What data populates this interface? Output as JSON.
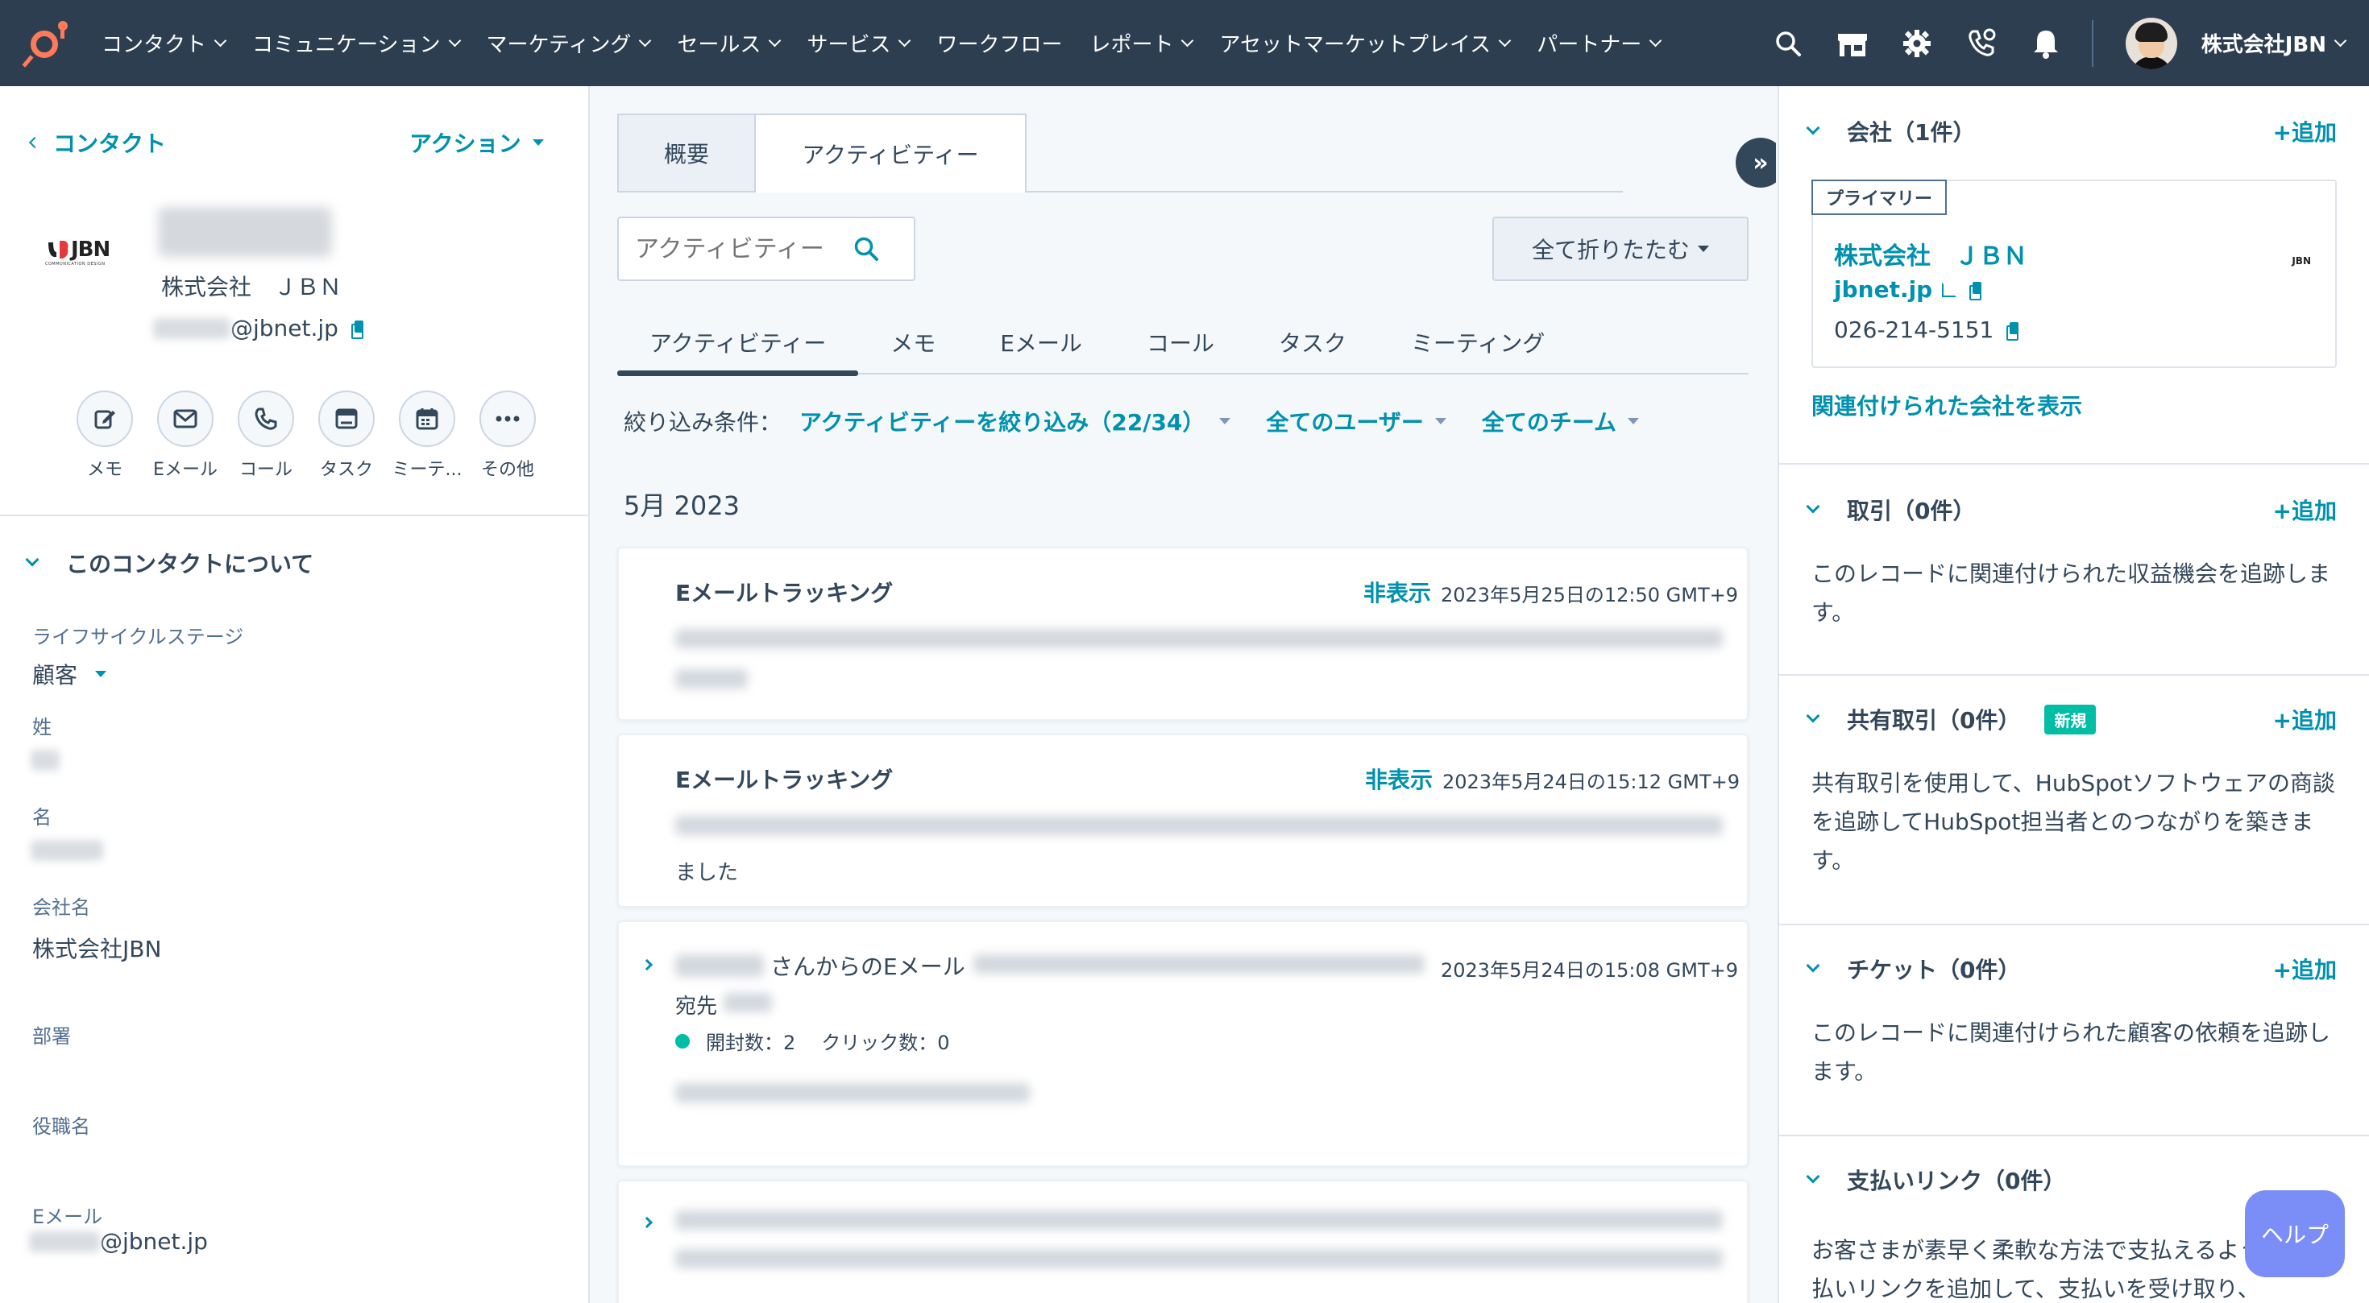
{
  "nav": {
    "items": [
      {
        "label": "コンタクト"
      },
      {
        "label": "コミュニケーション"
      },
      {
        "label": "マーケティング"
      },
      {
        "label": "セールス"
      },
      {
        "label": "サービス"
      },
      {
        "label": "ワークフロー"
      },
      {
        "label": "レポート"
      },
      {
        "label": "アセットマーケットプレイス"
      },
      {
        "label": "パートナー"
      }
    ],
    "account_name": "株式会社JBN",
    "brand_color": "#ff7a59",
    "bg_color": "#2d3e50"
  },
  "left": {
    "back_label": "コンタクト",
    "action_label": "アクション",
    "company_logo_text": "JBN",
    "company_logo_sub": "COMMUNICATION DESIGN",
    "company": "株式会社　ＪＢＮ",
    "email_domain": "@jbnet.jp",
    "quick_actions": [
      {
        "label": "メモ",
        "icon": "edit-icon"
      },
      {
        "label": "Eメール",
        "icon": "email-icon"
      },
      {
        "label": "コール",
        "icon": "phone-icon"
      },
      {
        "label": "タスク",
        "icon": "task-icon"
      },
      {
        "label": "ミーテ...",
        "icon": "calendar-icon"
      },
      {
        "label": "その他",
        "icon": "more-icon"
      }
    ],
    "about_title": "このコンタクトについて",
    "fields": {
      "lifecycle_label": "ライフサイクルステージ",
      "lifecycle_value": "顧客",
      "last_name_label": "姓",
      "first_name_label": "名",
      "company_label": "会社名",
      "company_value": "株式会社JBN",
      "department_label": "部署",
      "title_label": "役職名",
      "email_label": "Eメール",
      "email_value": "@jbnet.jp"
    }
  },
  "middle": {
    "tabs": [
      {
        "label": "概要"
      },
      {
        "label": "アクティビティー"
      }
    ],
    "search_placeholder": "アクティビティー",
    "collapse_all": "全て折りたたむ",
    "filter_tabs": [
      {
        "label": "アクティビティー"
      },
      {
        "label": "メモ"
      },
      {
        "label": "Eメール"
      },
      {
        "label": "コール"
      },
      {
        "label": "タスク"
      },
      {
        "label": "ミーティング"
      }
    ],
    "filter_label": "絞り込み条件：",
    "filter_activity": "アクティビティーを絞り込み（22/34）",
    "filter_users": "全てのユーザー",
    "filter_teams": "全てのチーム",
    "month": "5月 2023",
    "cards": [
      {
        "title": "Eメールトラッキング",
        "hide": "非表示",
        "date": "2023年5月25日の12:50 GMT+9"
      },
      {
        "title": "Eメールトラッキング",
        "hide": "非表示",
        "date": "2023年5月24日の15:12 GMT+9",
        "tail": "ました"
      },
      {
        "title": "さんからのEメール",
        "date": "2023年5月24日の15:08 GMT+9",
        "to": "宛先",
        "opens": "開封数：2",
        "clicks": "クリック数：0"
      }
    ]
  },
  "right": {
    "company": {
      "title": "会社（1件）",
      "add": "+追加",
      "primary": "プライマリー",
      "name": "株式会社　ＪＢＮ",
      "domain": "jbnet.jp",
      "phone": "026-214-5151",
      "logo_text": "JBN",
      "view_link": "関連付けられた会社を表示"
    },
    "deals": {
      "title": "取引（0件）",
      "add": "+追加",
      "desc": "このレコードに関連付けられた収益機会を追跡します。"
    },
    "shared_deals": {
      "title": "共有取引（0件）",
      "badge": "新規",
      "add": "+追加",
      "desc": "共有取引を使用して、HubSpotソフトウェアの商談を追跡してHubSpot担当者とのつながりを築きます。"
    },
    "tickets": {
      "title": "チケット（0件）",
      "add": "+追加",
      "desc": "このレコードに関連付けられた顧客の依頼を追跡します。"
    },
    "payment_links": {
      "title": "支払いリンク（0件）",
      "desc": "お客さまが素早く柔軟な方法で支払えるように。支払いリンクを追加して、支払いを受け取り、"
    }
  },
  "help": {
    "label": "ヘルプ"
  }
}
